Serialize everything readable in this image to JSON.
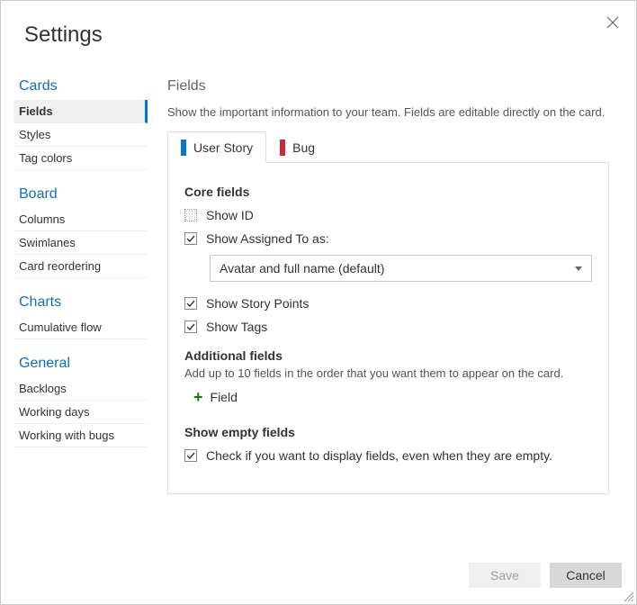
{
  "dialog": {
    "title": "Settings"
  },
  "sidebar": {
    "sections": [
      {
        "title": "Cards",
        "items": [
          {
            "label": "Fields",
            "active": true
          },
          {
            "label": "Styles"
          },
          {
            "label": "Tag colors"
          }
        ]
      },
      {
        "title": "Board",
        "items": [
          {
            "label": "Columns"
          },
          {
            "label": "Swimlanes"
          },
          {
            "label": "Card reordering"
          }
        ]
      },
      {
        "title": "Charts",
        "items": [
          {
            "label": "Cumulative flow"
          }
        ]
      },
      {
        "title": "General",
        "items": [
          {
            "label": "Backlogs"
          },
          {
            "label": "Working days"
          },
          {
            "label": "Working with bugs"
          }
        ]
      }
    ]
  },
  "main": {
    "title": "Fields",
    "description": "Show the important information to your team. Fields are editable directly on the card.",
    "tabs": [
      {
        "label": "User Story",
        "color": "blue",
        "active": true
      },
      {
        "label": "Bug",
        "color": "red"
      }
    ],
    "core": {
      "heading": "Core fields",
      "showId": {
        "label": "Show ID",
        "checked": false,
        "disabled": true
      },
      "showAssignedTo": {
        "label": "Show Assigned To as:",
        "checked": true
      },
      "assignedToSelect": "Avatar and full name (default)",
      "showStoryPoints": {
        "label": "Show Story Points",
        "checked": true
      },
      "showTags": {
        "label": "Show Tags",
        "checked": true
      }
    },
    "additional": {
      "heading": "Additional fields",
      "sub": "Add up to 10 fields in the order that you want them to appear on the card.",
      "addLabel": "Field"
    },
    "empty": {
      "heading": "Show empty fields",
      "label": "Check if you want to display fields, even when they are empty.",
      "checked": true
    }
  },
  "footer": {
    "save": "Save",
    "cancel": "Cancel"
  }
}
